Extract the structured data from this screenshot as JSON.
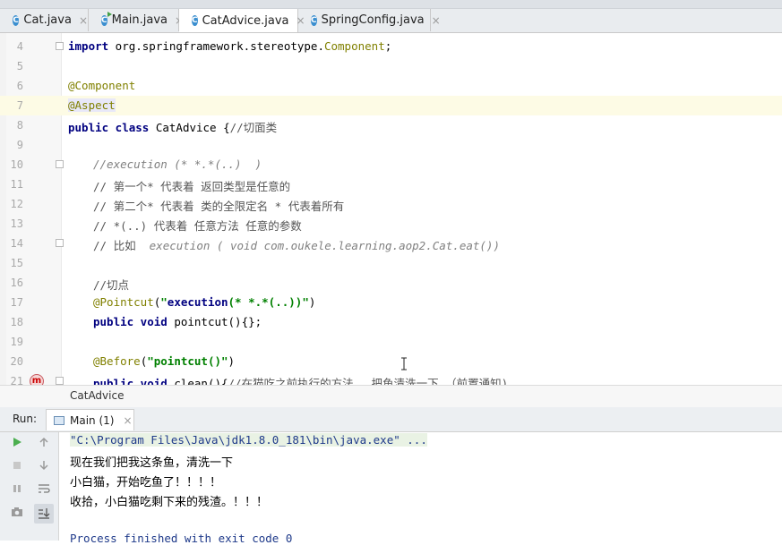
{
  "tabs": [
    {
      "label": "Cat.java",
      "icon": "class-icon",
      "active": false
    },
    {
      "label": "Main.java",
      "icon": "class-run-icon",
      "active": false
    },
    {
      "label": "CatAdvice.java",
      "icon": "class-icon",
      "active": true
    },
    {
      "label": "SpringConfig.java",
      "icon": "class-icon",
      "active": false
    }
  ],
  "tab_close_glyph": "×",
  "editor": {
    "line_numbers": [
      "4",
      "5",
      "6",
      "7",
      "8",
      "9",
      "10",
      "11",
      "12",
      "13",
      "14",
      "15",
      "16",
      "17",
      "18",
      "19",
      "20",
      "21"
    ],
    "l4": {
      "kw": "import",
      "rest": " org.springframework.stereotype.",
      "ann": "Component",
      "end": ";"
    },
    "l6": {
      "ann": "@Component"
    },
    "l7": {
      "ann": "@Aspect"
    },
    "l8": {
      "kw": "public class",
      "rest": " CatAdvice {",
      "cmt": "//切面类"
    },
    "l10": {
      "cmt": "//execution (* *.*(..)  )"
    },
    "l11": {
      "cmt": "// 第一个* 代表着 返回类型是任意的"
    },
    "l12": {
      "cmt": "// 第二个* 代表着 类的全限定名 * 代表着所有"
    },
    "l13": {
      "cmt": "// *(..) 代表着 任意方法 任意的参数"
    },
    "l14": {
      "cmt_a": "// 比如  ",
      "cmt_b": "execution ( void com.oukele.learning.aop2.Cat.eat())"
    },
    "l16": {
      "cmt": "//切点"
    },
    "l17": {
      "ann": "@Pointcut",
      "open": "(",
      "str_q1": "\"",
      "str_kw": "execution",
      "str_rest": "(* *.*(..))",
      "str_q2": "\"",
      "close": ")"
    },
    "l18": {
      "kw": "public void",
      "rest": " pointcut(){}",
      "end": ";"
    },
    "l20": {
      "ann": "@Before",
      "open": "(",
      "str": "\"pointcut()\"",
      "close": ")"
    },
    "l21": {
      "kw": "public void",
      "rest": " clean(){",
      "cmt": "//在猫吃之前执行的方法 ，把鱼清洗一下 （前置通知)"
    },
    "l21_icon": "m"
  },
  "breadcrumb": "CatAdvice",
  "run": {
    "label": "Run:",
    "tab_label": "Main (1)",
    "console": {
      "cmd": "\"C:\\Program Files\\Java\\jdk1.8.0_181\\bin\\java.exe\" ...",
      "out1": "现在我们把我这条鱼，清洗一下",
      "out2": "小白猫，开始吃鱼了！！！！",
      "out3": "收拾，小白猫吃剩下来的残渣。！！！",
      "finish": "Process finished with exit code 0"
    }
  },
  "colors": {
    "keyword": "#000080",
    "annotation": "#808000",
    "string": "#008000",
    "comment": "#808080",
    "highlight_line": "#fdfbe5"
  }
}
